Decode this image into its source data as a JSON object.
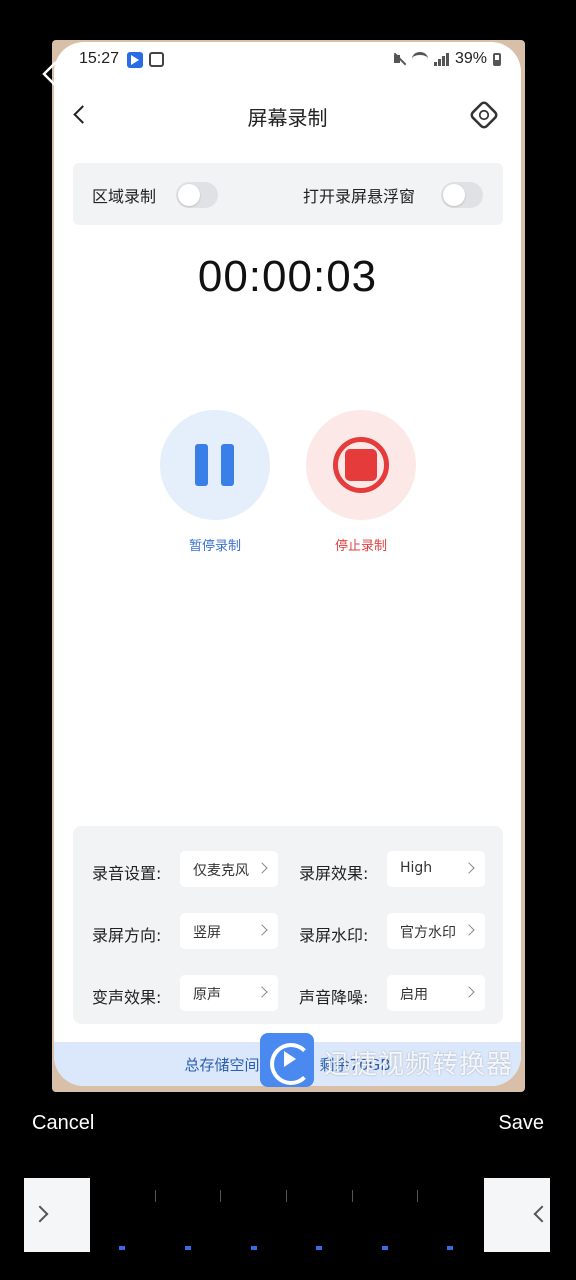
{
  "status_bar": {
    "time": "15:27",
    "battery": "39%"
  },
  "header": {
    "title": "屏幕录制"
  },
  "toggles": {
    "region_label": "区域录制",
    "float_label": "打开录屏悬浮窗"
  },
  "timer": "00:00:03",
  "controls": {
    "pause_label": "暂停录制",
    "stop_label": "停止录制"
  },
  "settings": [
    {
      "label": "录音设置:",
      "value": "仅麦克风"
    },
    {
      "label": "录屏效果:",
      "value": "High"
    },
    {
      "label": "录屏方向:",
      "value": "竖屏"
    },
    {
      "label": "录屏水印:",
      "value": "官方水印"
    },
    {
      "label": "变声效果:",
      "value": "原声"
    },
    {
      "label": "声音降噪:",
      "value": "启用"
    }
  ],
  "storage": {
    "text": "总存储空间100GB, 剩余70GB"
  },
  "watermark": {
    "text": "迅捷视频转换器"
  },
  "editor": {
    "cancel_label": "Cancel",
    "save_label": "Save"
  },
  "colors": {
    "accent_blue": "#3a7ee8",
    "stop_red": "#e53b3b",
    "card_bg": "#f2f3f5"
  }
}
